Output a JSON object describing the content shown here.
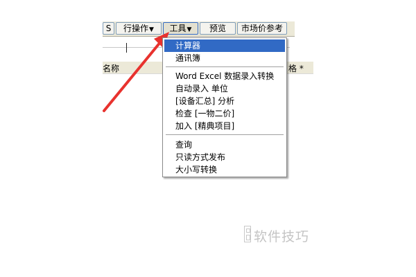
{
  "toolbar": {
    "cut_left": "S",
    "operate_label": "行操作",
    "tools_label": "工具",
    "preview_label": "预览",
    "market_ref_label": "市场价参考"
  },
  "grid": {
    "name_header": "名称",
    "price_header": "格 *"
  },
  "menu": {
    "items": [
      "计算器",
      "通讯簿",
      "Word Excel 数据录入转换",
      "自动录入 单位",
      "[设备汇总] 分析",
      "检查 [一物二价]",
      "加入 [精典项目]",
      "查询",
      "只读方式发布",
      "大小写转换"
    ],
    "selected_index": 0
  },
  "watermark": {
    "text": "软件技巧"
  },
  "colors": {
    "selection": "#316ac5",
    "arrow": "#e8322e",
    "toolbar_bg": "#ece9d8"
  }
}
